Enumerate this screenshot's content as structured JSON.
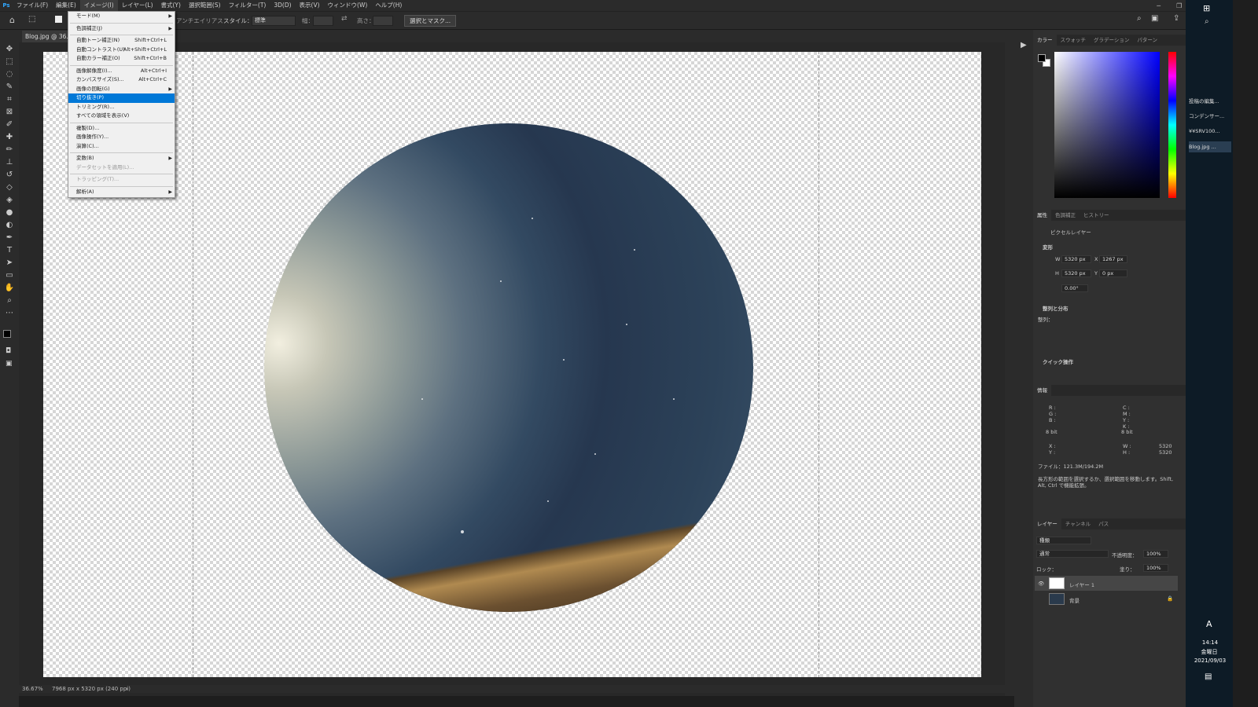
{
  "app": {
    "logo": "Ps"
  },
  "menubar": {
    "items": [
      "ファイル(F)",
      "編集(E)",
      "イメージ(I)",
      "レイヤー(L)",
      "書式(Y)",
      "選択範囲(S)",
      "フィルター(T)",
      "3D(D)",
      "表示(V)",
      "ウィンドウ(W)",
      "ヘルプ(H)"
    ],
    "active_index": 2
  },
  "options": {
    "antialias": "アンチエイリアス",
    "style_label": "スタイル：",
    "style_value": "標準",
    "width_label": "幅：",
    "height_label": "高さ：",
    "select_mask": "選択とマスク..."
  },
  "document": {
    "tab": "Blog.jpg @ 36.7",
    "zoom": "36.67%",
    "size": "7968 px x 5320 px (240 ppi)"
  },
  "image_menu": {
    "items": [
      {
        "label": "モード(M)",
        "submenu": true
      },
      {
        "sep": true
      },
      {
        "label": "色調補正(J)",
        "submenu": true
      },
      {
        "sep": true
      },
      {
        "label": "自動トーン補正(N)",
        "shortcut": "Shift+Ctrl+L"
      },
      {
        "label": "自動コントラスト(U)",
        "shortcut": "Alt+Shift+Ctrl+L"
      },
      {
        "label": "自動カラー補正(O)",
        "shortcut": "Shift+Ctrl+B"
      },
      {
        "sep": true
      },
      {
        "label": "画像解像度(I)...",
        "shortcut": "Alt+Ctrl+I"
      },
      {
        "label": "カンバスサイズ(S)...",
        "shortcut": "Alt+Ctrl+C"
      },
      {
        "label": "画像の回転(G)",
        "submenu": true
      },
      {
        "label": "切り抜き(P)",
        "highlight": true
      },
      {
        "label": "トリミング(R)..."
      },
      {
        "label": "すべての領域を表示(V)"
      },
      {
        "sep": true
      },
      {
        "label": "複製(D)..."
      },
      {
        "label": "画像操作(Y)..."
      },
      {
        "label": "演算(C)..."
      },
      {
        "sep": true
      },
      {
        "label": "変数(B)",
        "submenu": true
      },
      {
        "label": "データセットを適用(L)...",
        "disabled": true
      },
      {
        "sep": true
      },
      {
        "label": "トラッピング(T)...",
        "disabled": true
      },
      {
        "sep": true
      },
      {
        "label": "解析(A)",
        "submenu": true
      }
    ]
  },
  "color_panel": {
    "tabs": [
      "カラー",
      "スウォッチ",
      "グラデーション",
      "パターン"
    ]
  },
  "properties_panel": {
    "tabs": [
      "属性",
      "色調補正",
      "ヒストリー"
    ],
    "layer_type": "ピクセルレイヤー",
    "transform": "変形",
    "w_label": "W",
    "w": "5320 px",
    "x_label": "X",
    "x": "1267 px",
    "h_label": "H",
    "h": "5320 px",
    "y_label": "Y",
    "y": "0 px",
    "angle": "0.00°",
    "align_title": "整列と分布",
    "align_label": "整列：",
    "quick": "クイック操作"
  },
  "info_panel": {
    "tab": "情報",
    "r": "R :",
    "g": "G :",
    "b": "B :",
    "bit1": "8 bit",
    "c": "C :",
    "m": "M :",
    "y": "Y :",
    "k": "K :",
    "bit2": "8 bit",
    "xl": "X :",
    "yl": "Y :",
    "wl": "W :",
    "hl": "H :",
    "wv": "5320",
    "hv": "5320",
    "file": "ファイル：121.3M/194.2M",
    "hint": "長方形の範囲を選択するか、選択範囲を移動します。Shift, Alt, Ctrl で機能拡張。"
  },
  "layers_panel": {
    "tabs": [
      "レイヤー",
      "チャンネル",
      "パス"
    ],
    "kind": "種類",
    "blend": "通常",
    "opacity_label": "不透明度：",
    "opacity": "100%",
    "lock_label": "ロック：",
    "fill_label": "塗り：",
    "fill": "100%",
    "layers": [
      "レイヤー 1",
      "背景"
    ]
  },
  "taskbar": {
    "items": [
      "投稿の編集...",
      "コンデンサー...",
      "¥¥SRV100...",
      "Blog.jpg ..."
    ],
    "ime": "A",
    "time": "14:14",
    "day": "金曜日",
    "date": "2021/09/03"
  }
}
